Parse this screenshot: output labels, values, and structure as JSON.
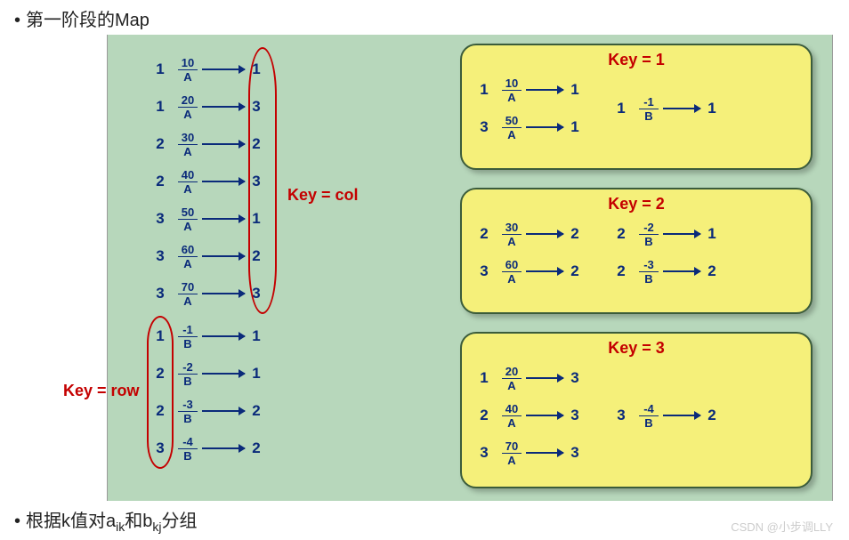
{
  "title_top": "第一阶段的Map",
  "title_bottom_pre": "根据k值对a",
  "title_bottom_mid": "和b",
  "title_bottom_post": "分组",
  "sub_ik": "ik",
  "sub_kj": "kj",
  "bullet": "•",
  "labels": {
    "key_col": "Key = col",
    "key_row": "Key = row",
    "key1": "Key = 1",
    "key2": "Key = 2",
    "key3": "Key = 3"
  },
  "matrixA": [
    {
      "l": "1",
      "v": "10",
      "m": "A",
      "r": "1"
    },
    {
      "l": "1",
      "v": "20",
      "m": "A",
      "r": "3"
    },
    {
      "l": "2",
      "v": "30",
      "m": "A",
      "r": "2"
    },
    {
      "l": "2",
      "v": "40",
      "m": "A",
      "r": "3"
    },
    {
      "l": "3",
      "v": "50",
      "m": "A",
      "r": "1"
    },
    {
      "l": "3",
      "v": "60",
      "m": "A",
      "r": "2"
    },
    {
      "l": "3",
      "v": "70",
      "m": "A",
      "r": "3"
    }
  ],
  "matrixB": [
    {
      "l": "1",
      "v": "-1",
      "m": "B",
      "r": "1"
    },
    {
      "l": "2",
      "v": "-2",
      "m": "B",
      "r": "1"
    },
    {
      "l": "2",
      "v": "-3",
      "m": "B",
      "r": "2"
    },
    {
      "l": "3",
      "v": "-4",
      "m": "B",
      "r": "2"
    }
  ],
  "group1": {
    "A": [
      {
        "l": "1",
        "v": "10",
        "m": "A",
        "r": "1"
      },
      {
        "l": "3",
        "v": "50",
        "m": "A",
        "r": "1"
      }
    ],
    "B": [
      {
        "l": "1",
        "v": "-1",
        "m": "B",
        "r": "1"
      }
    ]
  },
  "group2": {
    "A": [
      {
        "l": "2",
        "v": "30",
        "m": "A",
        "r": "2"
      },
      {
        "l": "3",
        "v": "60",
        "m": "A",
        "r": "2"
      }
    ],
    "B": [
      {
        "l": "2",
        "v": "-2",
        "m": "B",
        "r": "1"
      },
      {
        "l": "2",
        "v": "-3",
        "m": "B",
        "r": "2"
      }
    ]
  },
  "group3": {
    "A": [
      {
        "l": "1",
        "v": "20",
        "m": "A",
        "r": "3"
      },
      {
        "l": "2",
        "v": "40",
        "m": "A",
        "r": "3"
      },
      {
        "l": "3",
        "v": "70",
        "m": "A",
        "r": "3"
      }
    ],
    "B": [
      {
        "l": "3",
        "v": "-4",
        "m": "B",
        "r": "2"
      }
    ]
  },
  "watermark": "CSDN @小步调LLY"
}
